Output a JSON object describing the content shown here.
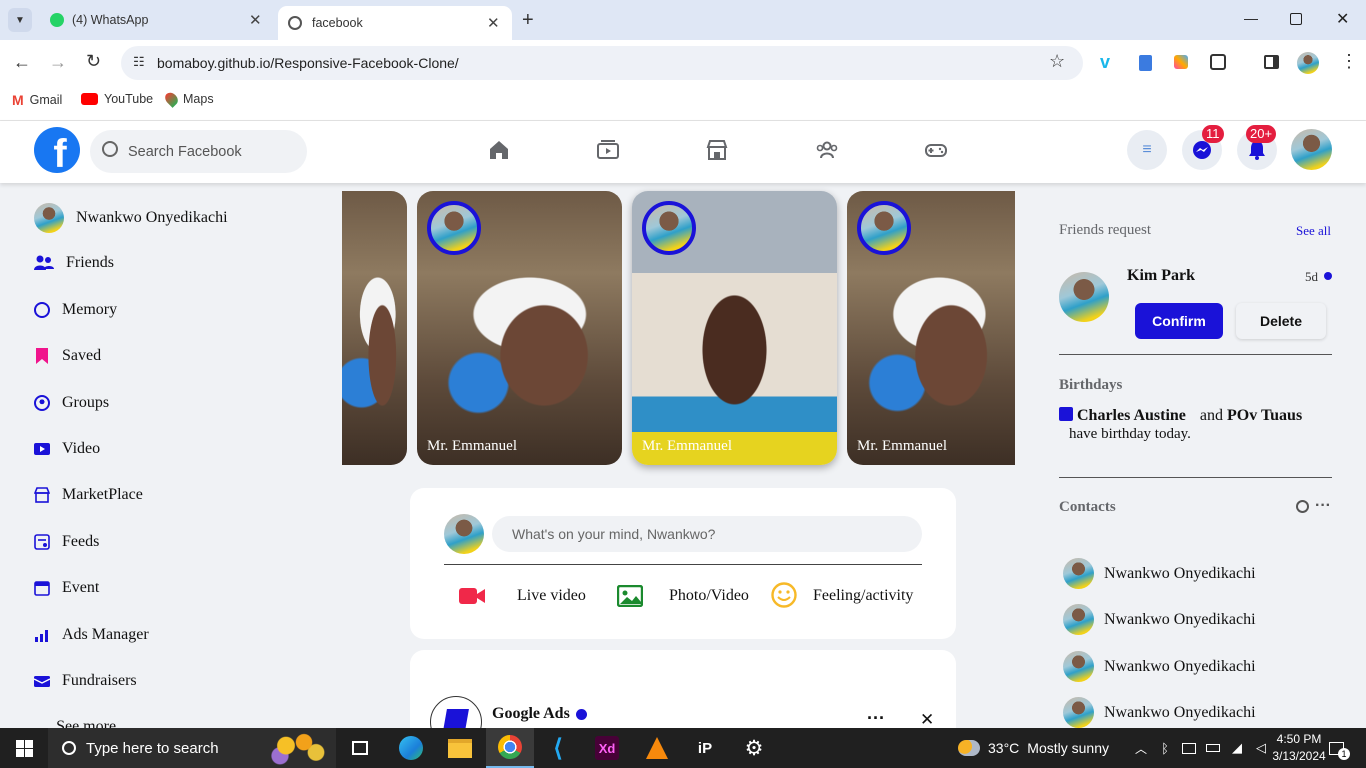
{
  "browser": {
    "tabs": [
      {
        "label": "(4) WhatsApp"
      },
      {
        "label": "facebook"
      }
    ],
    "url": "bomaboy.github.io/Responsive-Facebook-Clone/",
    "bookmarks": [
      {
        "label": "Gmail",
        "icon": "gmail-icon"
      },
      {
        "label": "YouTube",
        "icon": "youtube-icon"
      },
      {
        "label": "Maps",
        "icon": "maps-icon"
      }
    ]
  },
  "header": {
    "search_placeholder": "Search Facebook",
    "messenger_badge": "11",
    "notification_badge": "20+"
  },
  "sidebar": {
    "profile_name": "Nwankwo Onyedikachi",
    "items": [
      {
        "label": "Friends",
        "icon": "friends-icon"
      },
      {
        "label": "Memory",
        "icon": "clock-icon"
      },
      {
        "label": "Saved",
        "icon": "bookmark-icon"
      },
      {
        "label": "Groups",
        "icon": "groups-icon"
      },
      {
        "label": "Video",
        "icon": "video-icon"
      },
      {
        "label": "MarketPlace",
        "icon": "store-icon"
      },
      {
        "label": "Feeds",
        "icon": "feeds-icon"
      },
      {
        "label": "Event",
        "icon": "calendar-icon"
      },
      {
        "label": "Ads Manager",
        "icon": "chart-icon"
      },
      {
        "label": "Fundraisers",
        "icon": "fundraiser-icon"
      },
      {
        "label": "See more",
        "icon": "chevron-down-icon"
      }
    ]
  },
  "stories": [
    {
      "name": ""
    },
    {
      "name": "Mr. Emmanuel"
    },
    {
      "name": "Mr. Emmanuel"
    },
    {
      "name": "Mr. Emmanuel"
    }
  ],
  "composer": {
    "placeholder": "What's on your mind, Nwankwo?",
    "actions": [
      {
        "label": "Live video"
      },
      {
        "label": "Photo/Video"
      },
      {
        "label": "Feeling/activity"
      }
    ]
  },
  "post": {
    "author": "Google Ads"
  },
  "right": {
    "friends_title": "Friends request",
    "see_all": "See all",
    "request_name": "Kim Park",
    "request_time": "5d",
    "confirm": "Confirm",
    "delete": "Delete",
    "birthdays_title": "Birthdays",
    "birthday_name1": "Charles Austine",
    "birthday_and": "and",
    "birthday_name2": "POv Tuaus",
    "birthday_suffix": "have birthday today.",
    "contacts_title": "Contacts",
    "contacts": [
      "Nwankwo Onyedikachi",
      "Nwankwo Onyedikachi",
      "Nwankwo Onyedikachi",
      "Nwankwo Onyedikachi"
    ]
  },
  "taskbar": {
    "search_placeholder": "Type here to search",
    "temperature": "33°C",
    "weather": "Mostly sunny",
    "time": "4:50 PM",
    "date": "3/13/2024",
    "notifications": "1"
  },
  "colors": {
    "facebook_blue": "#1877f2",
    "accent_blue": "#1a12d8",
    "badge_red": "#e41e3f"
  }
}
